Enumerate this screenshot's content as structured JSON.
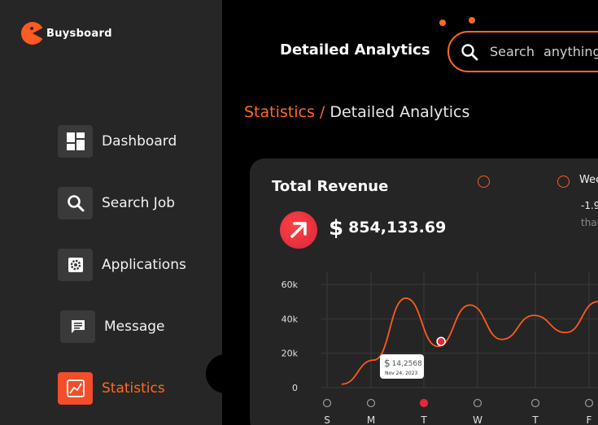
{
  "brand": {
    "name": "Buysboard",
    "accent": "#ff6a1f"
  },
  "sidebar": {
    "items": [
      {
        "label": "Dashboard",
        "icon": "dashboard-icon"
      },
      {
        "label": "Search Job",
        "icon": "search-icon"
      },
      {
        "label": "Applications",
        "icon": "gear-icon"
      },
      {
        "label": "Message",
        "icon": "message-icon"
      },
      {
        "label": "Statistics",
        "icon": "chart-icon",
        "active": true
      }
    ]
  },
  "header": {
    "title": "Detailed Analytics",
    "search_placeholder": "Search anything"
  },
  "breadcrumb": {
    "parent": "Statistics",
    "separator": "/",
    "current": "Detailed Analytics"
  },
  "card": {
    "title": "Total Revenue",
    "currency_symbol": "$",
    "amount": "854,133.69",
    "legend_label": "Wee",
    "change_text": "-1.9",
    "change_sub": "thar"
  },
  "tooltip": {
    "symbol": "$",
    "value": "14,2568",
    "date": "Nov 24, 2023"
  },
  "chart_data": {
    "type": "line",
    "y_ticks": [
      "60k",
      "40k",
      "20k",
      "0"
    ],
    "x_labels": [
      "S",
      "M",
      "T",
      "W",
      "T",
      "F"
    ],
    "ylim": [
      0,
      60000
    ],
    "selected_day_index": 2,
    "series": [
      {
        "values": [
          2000,
          16000,
          52000,
          24000,
          48000,
          28000,
          42000,
          32000,
          50000
        ]
      }
    ]
  }
}
